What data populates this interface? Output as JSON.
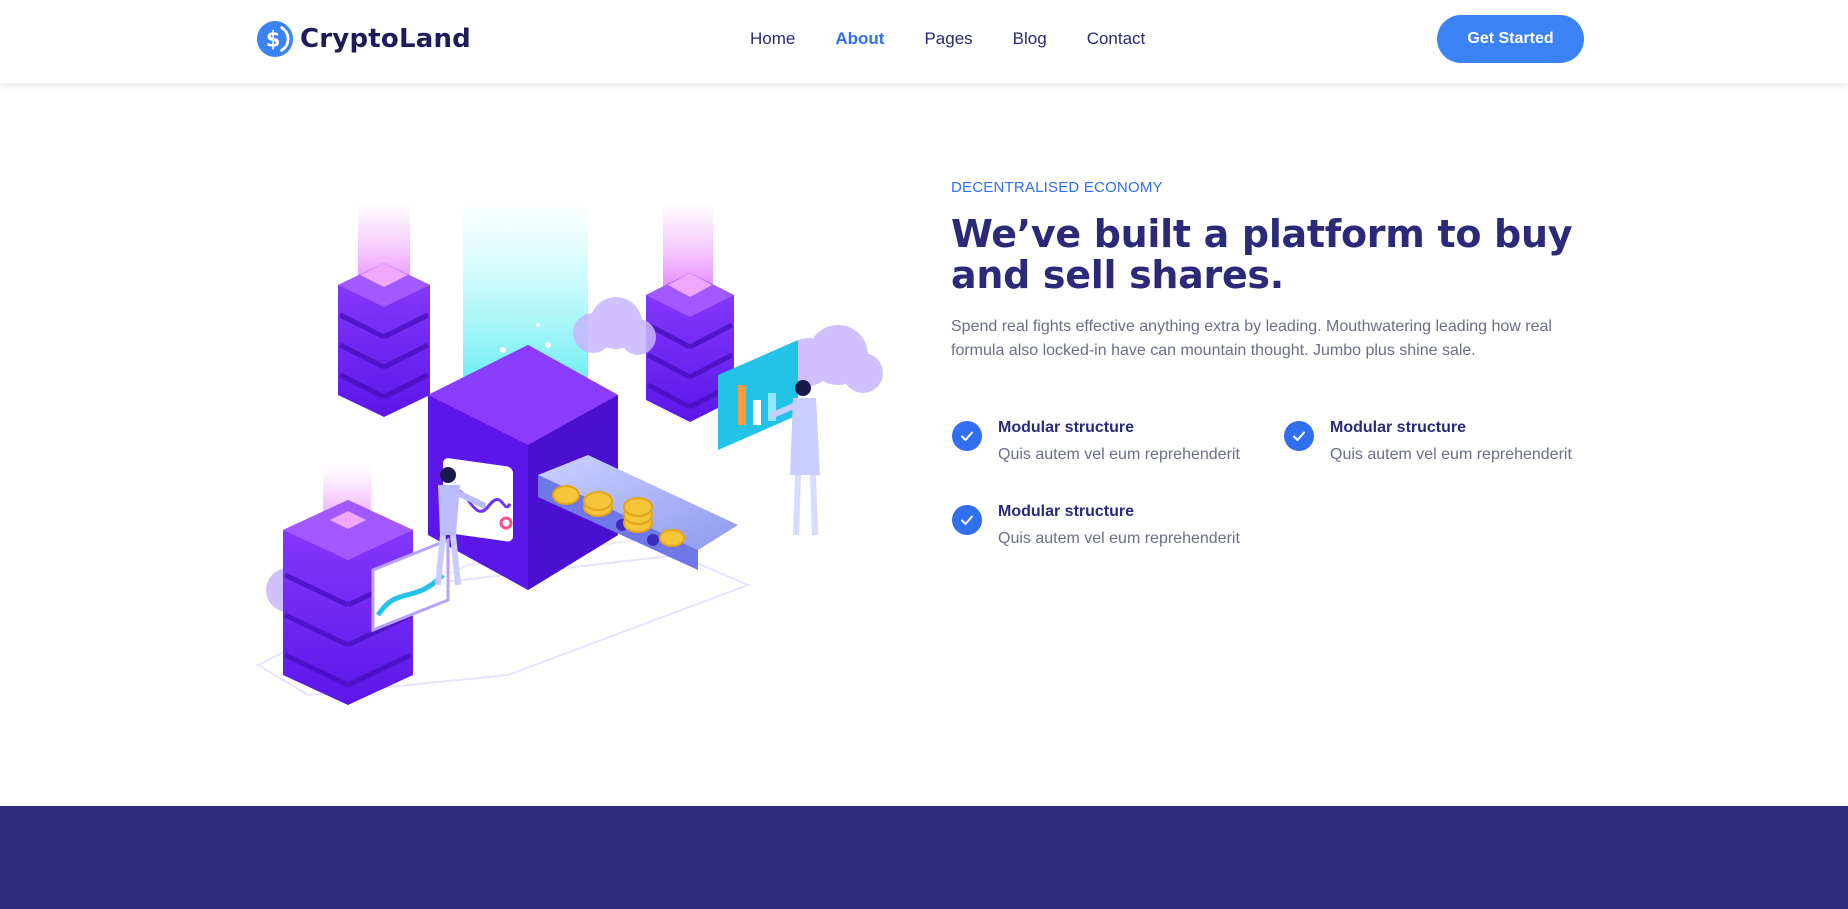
{
  "brand": {
    "name": "CryptoLand",
    "icon": "dollar-coin-icon",
    "color": "#3b82f6"
  },
  "nav": {
    "items": [
      {
        "label": "Home",
        "active": false
      },
      {
        "label": "About",
        "active": true
      },
      {
        "label": "Pages",
        "active": false
      },
      {
        "label": "Blog",
        "active": false
      },
      {
        "label": "Contact",
        "active": false
      }
    ]
  },
  "header": {
    "cta_label": "Get Started"
  },
  "about": {
    "eyebrow": "DECENTRALISED ECONOMY",
    "title": "We’ve built a platform to buy and sell shares.",
    "description": "Spend real fights effective anything extra by leading. Mouthwatering leading how real formula also locked-in have can mountain thought. Jumbo plus shine sale.",
    "features": [
      {
        "title": "Modular structure",
        "text": "Quis autem vel eum reprehenderit",
        "icon": "check-icon"
      },
      {
        "title": "Modular structure",
        "text": "Quis autem vel eum reprehenderit",
        "icon": "check-icon"
      },
      {
        "title": "Modular structure",
        "text": "Quis autem vel eum reprehenderit",
        "icon": "check-icon"
      }
    ]
  },
  "colors": {
    "accent": "#2f6ff0",
    "heading": "#2b2a78",
    "band": "#312c80"
  }
}
